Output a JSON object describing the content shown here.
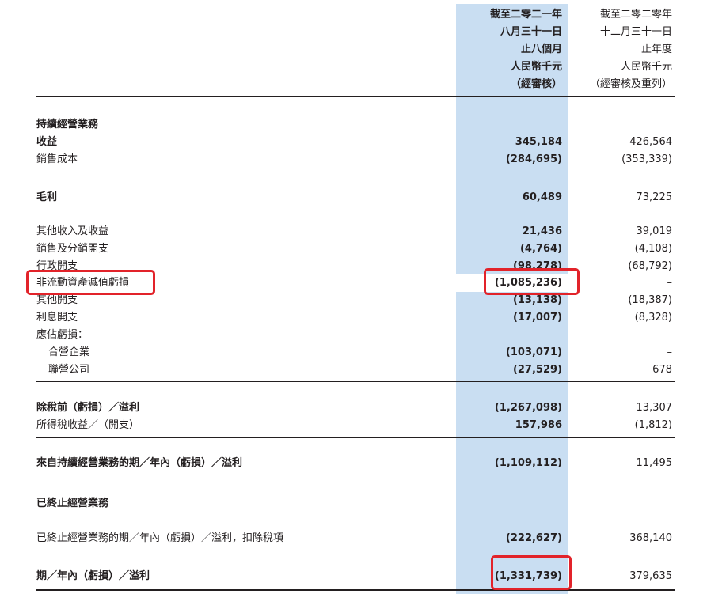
{
  "header": {
    "col1": [
      "截至二零二一年",
      "八月三十一日",
      "止八個月",
      "人民幣千元",
      "（經審核）"
    ],
    "col2": [
      "截至二零二零年",
      "十二月三十一日",
      "止年度",
      "人民幣千元",
      "（經審核及重列）"
    ]
  },
  "rows": [
    {
      "label": "持續經營業務",
      "c1": "",
      "c2": ""
    },
    {
      "label": "收益",
      "c1": "345,184",
      "c2": "426,564"
    },
    {
      "label": "銷售成本",
      "c1": "(284,695)",
      "c2": "(353,339)"
    },
    {
      "label": "毛利",
      "c1": "60,489",
      "c2": "73,225"
    },
    {
      "label": "其他收入及收益",
      "c1": "21,436",
      "c2": "39,019"
    },
    {
      "label": "銷售及分銷開支",
      "c1": "(4,764)",
      "c2": "(4,108)"
    },
    {
      "label": "行政開支",
      "c1": "(98,278)",
      "c2": "(68,792)"
    },
    {
      "label": "非流動資產減值虧損",
      "c1": "(1,085,236)",
      "c2": "–"
    },
    {
      "label": "其他開支",
      "c1": "(13,138)",
      "c2": "(18,387)"
    },
    {
      "label": "利息開支",
      "c1": "(17,007)",
      "c2": "(8,328)"
    },
    {
      "label": "應佔虧損：",
      "c1": "",
      "c2": ""
    },
    {
      "label": "合營企業",
      "c1": "(103,071)",
      "c2": "–"
    },
    {
      "label": "聯營公司",
      "c1": "(27,529)",
      "c2": "678"
    },
    {
      "label": "除稅前（虧損）／溢利",
      "c1": "(1,267,098)",
      "c2": "13,307"
    },
    {
      "label": "所得稅收益／（開支）",
      "c1": "157,986",
      "c2": "(1,812)"
    },
    {
      "label": "來自持續經營業務的期／年內（虧損）／溢利",
      "c1": "(1,109,112)",
      "c2": "11,495"
    },
    {
      "label": "已終止經營業務",
      "c1": "",
      "c2": ""
    },
    {
      "label": "已終止經營業務的期／年內（虧損）／溢利，扣除稅項",
      "c1": "(222,627)",
      "c2": "368,140"
    },
    {
      "label": "期／年內（虧損）／溢利",
      "c1": "(1,331,739)",
      "c2": "379,635"
    }
  ]
}
